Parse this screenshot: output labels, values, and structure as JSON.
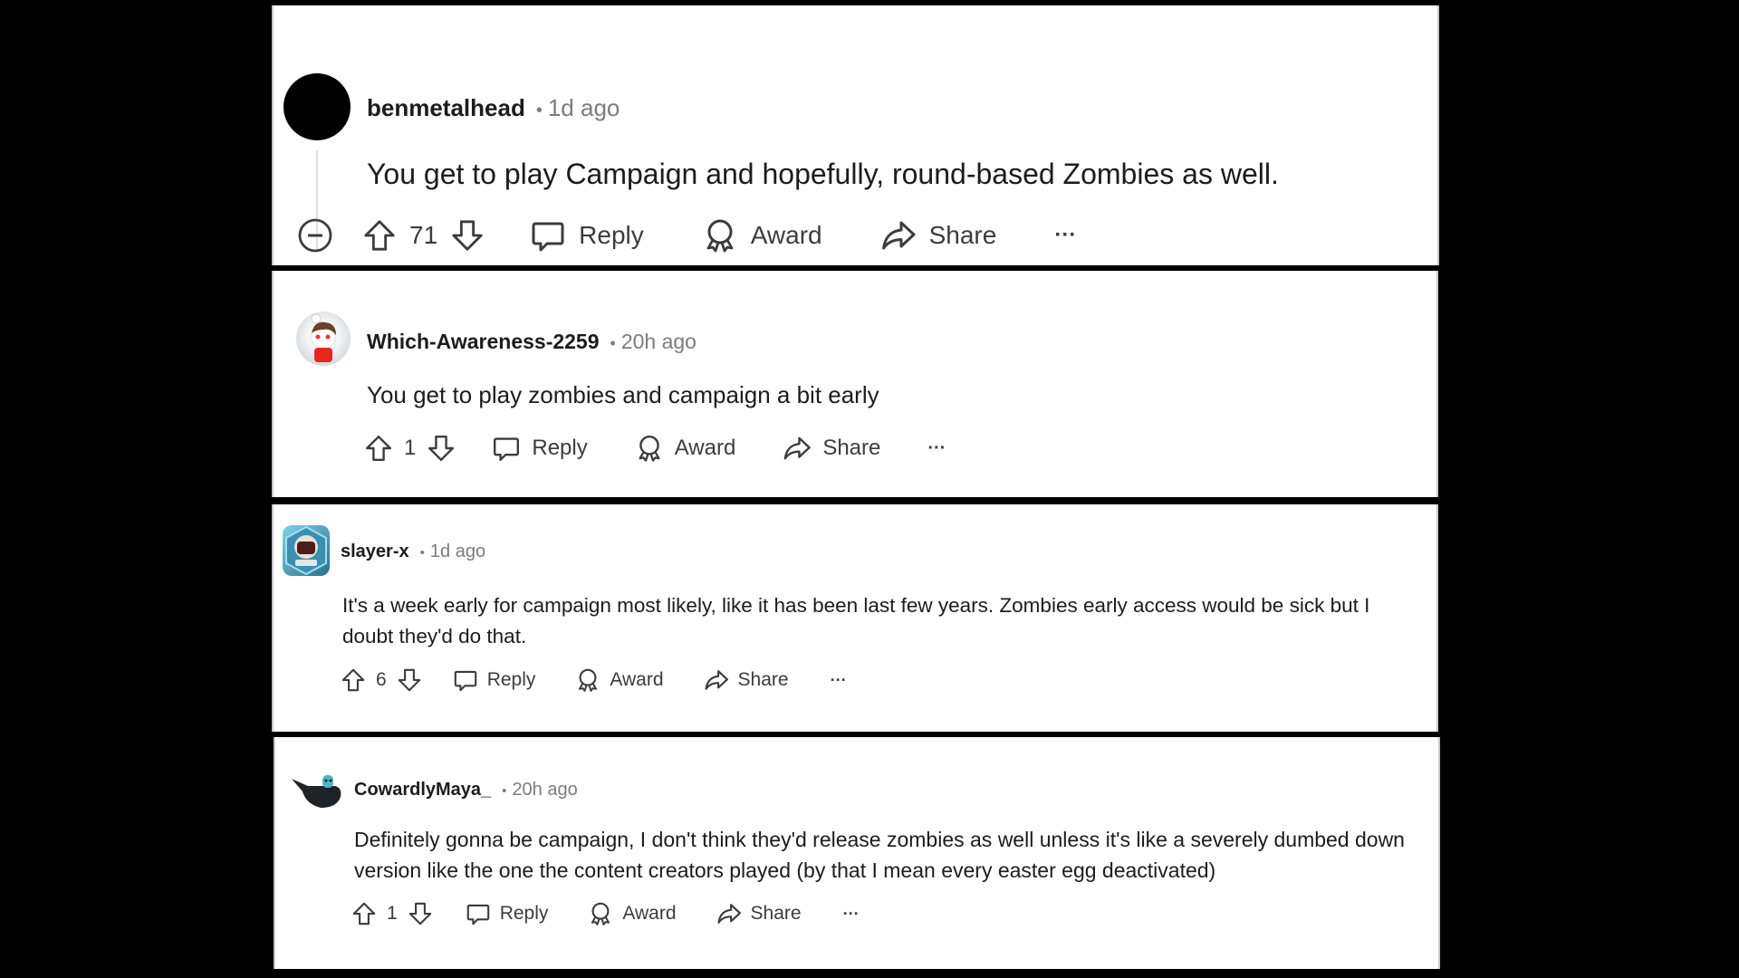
{
  "comments": [
    {
      "username": "benmetalhead",
      "separator": "•",
      "time": "1d ago",
      "text": "You get to play Campaign and hopefully, round-based Zombies as well.",
      "score": "71",
      "reply": "Reply",
      "award": "Award",
      "share": "Share",
      "more": "···",
      "avatar": "black-circle-avatar",
      "collapsible": true
    },
    {
      "username": "Which-Awareness-2259",
      "separator": "•",
      "time": "20h ago",
      "text": "You get to play zombies and campaign a bit early",
      "score": "1",
      "reply": "Reply",
      "award": "Award",
      "share": "Share",
      "more": "···",
      "avatar": "snoo-avatar-red-shirt"
    },
    {
      "username": "slayer-x",
      "separator": "•",
      "time": "1d ago",
      "text_lines": [
        "It's a week early for campaign most likely, like it has been last few years. Zombies early access would be sick but I",
        "doubt they'd do that."
      ],
      "score": "6",
      "reply": "Reply",
      "award": "Award",
      "share": "Share",
      "more": "···",
      "avatar": "hexagon-helmet-avatar"
    },
    {
      "username": "CowardlyMaya_",
      "separator": "•",
      "time": "20h ago",
      "text_lines": [
        "Definitely gonna be campaign, I don't think they'd release zombies as well unless it's like a severely dumbed down",
        "version like the one the content creators played (by that I mean every easter egg deactivated)"
      ],
      "score": "1",
      "reply": "Reply",
      "award": "Award",
      "share": "Share",
      "more": "···",
      "avatar": "dark-creature-avatar"
    }
  ],
  "colors": {
    "background": "#000000",
    "panel": "#ffffff",
    "text": "#1c1c1c",
    "meta": "#7c7c7c",
    "icon": "#3c3c3c"
  }
}
